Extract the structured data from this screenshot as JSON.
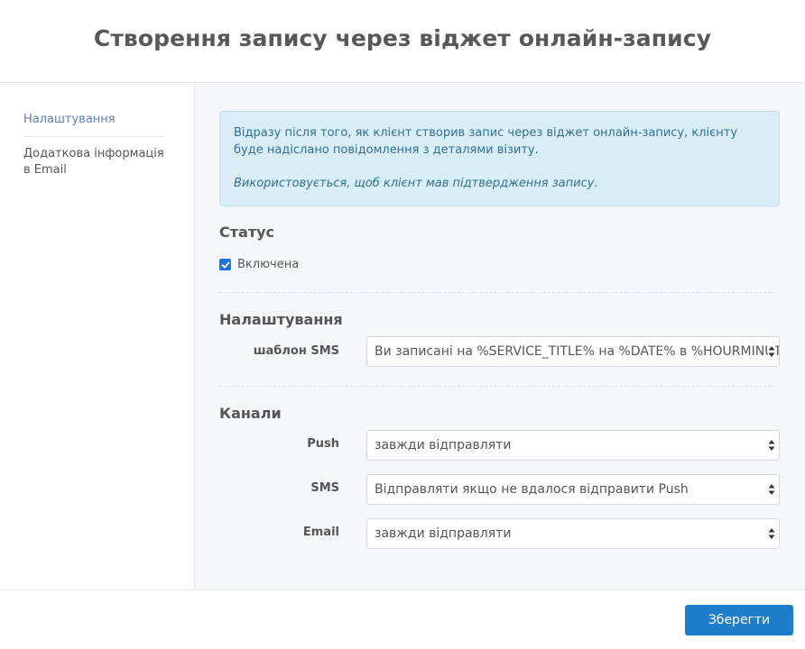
{
  "header": {
    "title": "Створення запису через віджет онлайн-запису"
  },
  "sidebar": {
    "items": [
      {
        "label": "Налаштування",
        "active": true
      },
      {
        "label": "Додаткова інформація в Email",
        "active": false
      }
    ]
  },
  "info": {
    "text": "Відразу після того, як клієнт створив запис через віджет онлайн-запису, клієнту буде надіслано повідомлення з деталями візиту.",
    "note": "Використовується, щоб клієнт мав підтвердження запису."
  },
  "status": {
    "title": "Статус",
    "checkbox_label": "Включена",
    "checked": true
  },
  "settings": {
    "title": "Налаштування",
    "sms_template_label": "шаблон SMS",
    "sms_template_value": "Ви записані на %SERVICE_TITLE% на %DATE% в %HOURMINUTES%"
  },
  "channels": {
    "title": "Канали",
    "push_label": "Push",
    "push_value": "завжди відправляти",
    "sms_label": "SMS",
    "sms_value": "Відправляти якщо не вдалося відправити Push",
    "email_label": "Email",
    "email_value": "завжди відправляти"
  },
  "footer": {
    "save_label": "Зберегти"
  },
  "colors": {
    "accent": "#1f7ec9",
    "info_bg": "#d9edf7",
    "info_text": "#31708f",
    "checkbox": "#1a73e8"
  },
  "icons": {
    "select_arrows": "updown-arrows-icon",
    "checkbox": "checkmark-icon"
  }
}
